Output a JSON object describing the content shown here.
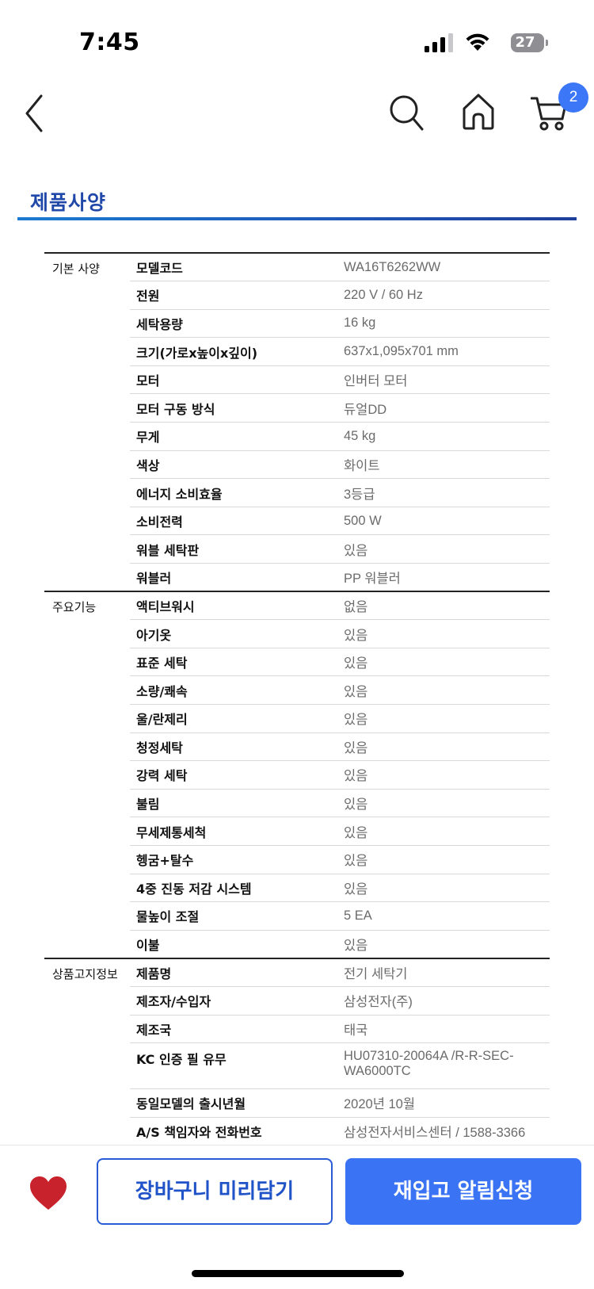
{
  "status_bar": {
    "time": "7:45",
    "battery": "27"
  },
  "nav": {
    "cart_count": "2"
  },
  "section": {
    "title": "제품사양"
  },
  "spec_groups": [
    {
      "label": "기본 사양",
      "rows": [
        {
          "key": "모델코드",
          "value": "WA16T6262WW"
        },
        {
          "key": "전원",
          "value": "220 V / 60 Hz"
        },
        {
          "key": "세탁용량",
          "value": "16 kg"
        },
        {
          "key": "크기(가로x높이x깊이)",
          "value": "637x1,095x701 mm"
        },
        {
          "key": "모터",
          "value": "인버터 모터"
        },
        {
          "key": "모터 구동 방식",
          "value": "듀얼DD"
        },
        {
          "key": "무게",
          "value": "45 kg"
        },
        {
          "key": "색상",
          "value": "화이트"
        },
        {
          "key": "에너지 소비효율",
          "value": "3등급"
        },
        {
          "key": "소비전력",
          "value": "500 W"
        },
        {
          "key": "워블 세탁판",
          "value": "있음"
        },
        {
          "key": "워블러",
          "value": "PP 워블러"
        }
      ]
    },
    {
      "label": "주요기능",
      "rows": [
        {
          "key": "액티브워시",
          "value": "없음"
        },
        {
          "key": "아기옷",
          "value": "있음"
        },
        {
          "key": "표준 세탁",
          "value": "있음"
        },
        {
          "key": "소량/쾌속",
          "value": "있음"
        },
        {
          "key": "울/란제리",
          "value": "있음"
        },
        {
          "key": "청정세탁",
          "value": "있음"
        },
        {
          "key": "강력 세탁",
          "value": "있음"
        },
        {
          "key": "불림",
          "value": "있음"
        },
        {
          "key": "무세제통세척",
          "value": "있음"
        },
        {
          "key": "헹굼+탈수",
          "value": "있음"
        },
        {
          "key": "4중 진동 저감 시스템",
          "value": "있음"
        },
        {
          "key": "물높이 조절",
          "value": "5 EA"
        },
        {
          "key": "이불",
          "value": "있음"
        }
      ]
    },
    {
      "label": "상품고지정보",
      "rows": [
        {
          "key": "제품명",
          "value": "전기 세탁기"
        },
        {
          "key": "제조자/수입자",
          "value": "삼성전자(주)"
        },
        {
          "key": "제조국",
          "value": "태국"
        },
        {
          "key": "KC 인증 필 유무",
          "value": "HU07310-20064A /R-R-SEC-WA6000TC"
        },
        {
          "key": "동일모델의 출시년월",
          "value": "2020년 10월"
        },
        {
          "key": "A/S 책임자와 전화번호",
          "value": "삼성전자서비스센터 / 1588-3366"
        }
      ]
    }
  ],
  "bottom_bar": {
    "add_to_cart_label": "장바구니 미리담기",
    "restock_label": "재입고 알림신청"
  },
  "colors": {
    "accent": "#3b73f5",
    "title": "#1f48a8",
    "heart": "#c8232c"
  }
}
